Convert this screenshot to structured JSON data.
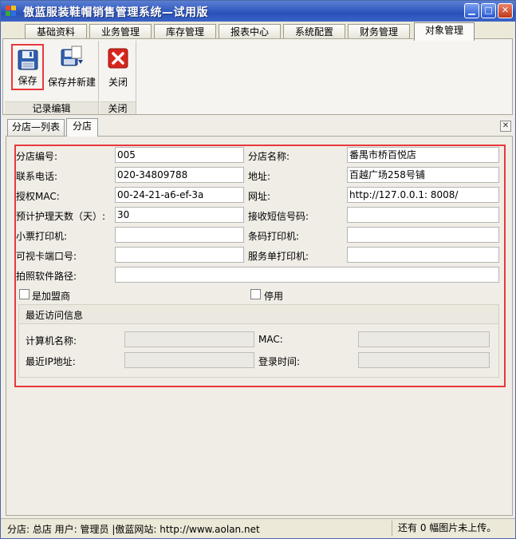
{
  "window": {
    "title": "傲蓝服装鞋帽销售管理系统—试用版",
    "controls": [
      "minimize",
      "maximize",
      "close"
    ]
  },
  "main_tabs": [
    {
      "label": "基础资料"
    },
    {
      "label": "业务管理"
    },
    {
      "label": "库存管理"
    },
    {
      "label": "报表中心"
    },
    {
      "label": "系统配置"
    },
    {
      "label": "财务管理"
    },
    {
      "label": "对象管理",
      "active": true
    }
  ],
  "ribbon": {
    "groups": [
      {
        "caption": "记录编辑",
        "buttons": [
          {
            "label": "保存",
            "icon": "floppy-disk-icon",
            "selected": true
          },
          {
            "label": "保存并新建",
            "icon": "save-new-icon"
          }
        ]
      },
      {
        "caption": "关闭",
        "buttons": [
          {
            "label": "关闭",
            "icon": "close-x-icon"
          }
        ]
      }
    ]
  },
  "sub_tabs": [
    {
      "label": "分店—列表"
    },
    {
      "label": "分店",
      "active": true
    }
  ],
  "form": {
    "branch_code": {
      "label": "分店编号:",
      "value": "005"
    },
    "branch_name": {
      "label": "分店名称:",
      "value": "番禺市桥百悦店"
    },
    "phone": {
      "label": "联系电话:",
      "value": "020-34809788"
    },
    "address": {
      "label": "地址:",
      "value": "百越广场258号铺"
    },
    "auth_mac": {
      "label": "授权MAC:",
      "value": "00-24-21-a6-ef-3a"
    },
    "website": {
      "label": "网址:",
      "value": "http://127.0.0.1: 8008/"
    },
    "care_days": {
      "label": "预计护理天数（天）:",
      "value": "30"
    },
    "sms_number": {
      "label": "接收短信号码:",
      "value": ""
    },
    "receipt_printer": {
      "label": "小票打印机:",
      "value": ""
    },
    "barcode_printer": {
      "label": "条码打印机:",
      "value": ""
    },
    "visual_card_port": {
      "label": "可视卡端口号:",
      "value": ""
    },
    "service_printer": {
      "label": "服务单打印机:",
      "value": ""
    },
    "photo_path": {
      "label": "拍照软件路径:",
      "value": ""
    },
    "is_franchise": {
      "label": "是加盟商",
      "checked": false
    },
    "disabled": {
      "label": "停用",
      "checked": false
    }
  },
  "recent_access": {
    "title": "最近访问信息",
    "computer_name": {
      "label": "计算机名称:",
      "value": ""
    },
    "mac": {
      "label": "MAC:",
      "value": ""
    },
    "last_ip": {
      "label": "最近IP地址:",
      "value": ""
    },
    "login_time": {
      "label": "登录时间:",
      "value": ""
    }
  },
  "status": {
    "left": "分店: 总店  用户: 管理员  |傲蓝网站: http://www.aolan.net",
    "right": "还有 0 幅图片未上传。"
  },
  "colors": {
    "highlight": "#e8383d",
    "titlebar": "#2851b8"
  }
}
